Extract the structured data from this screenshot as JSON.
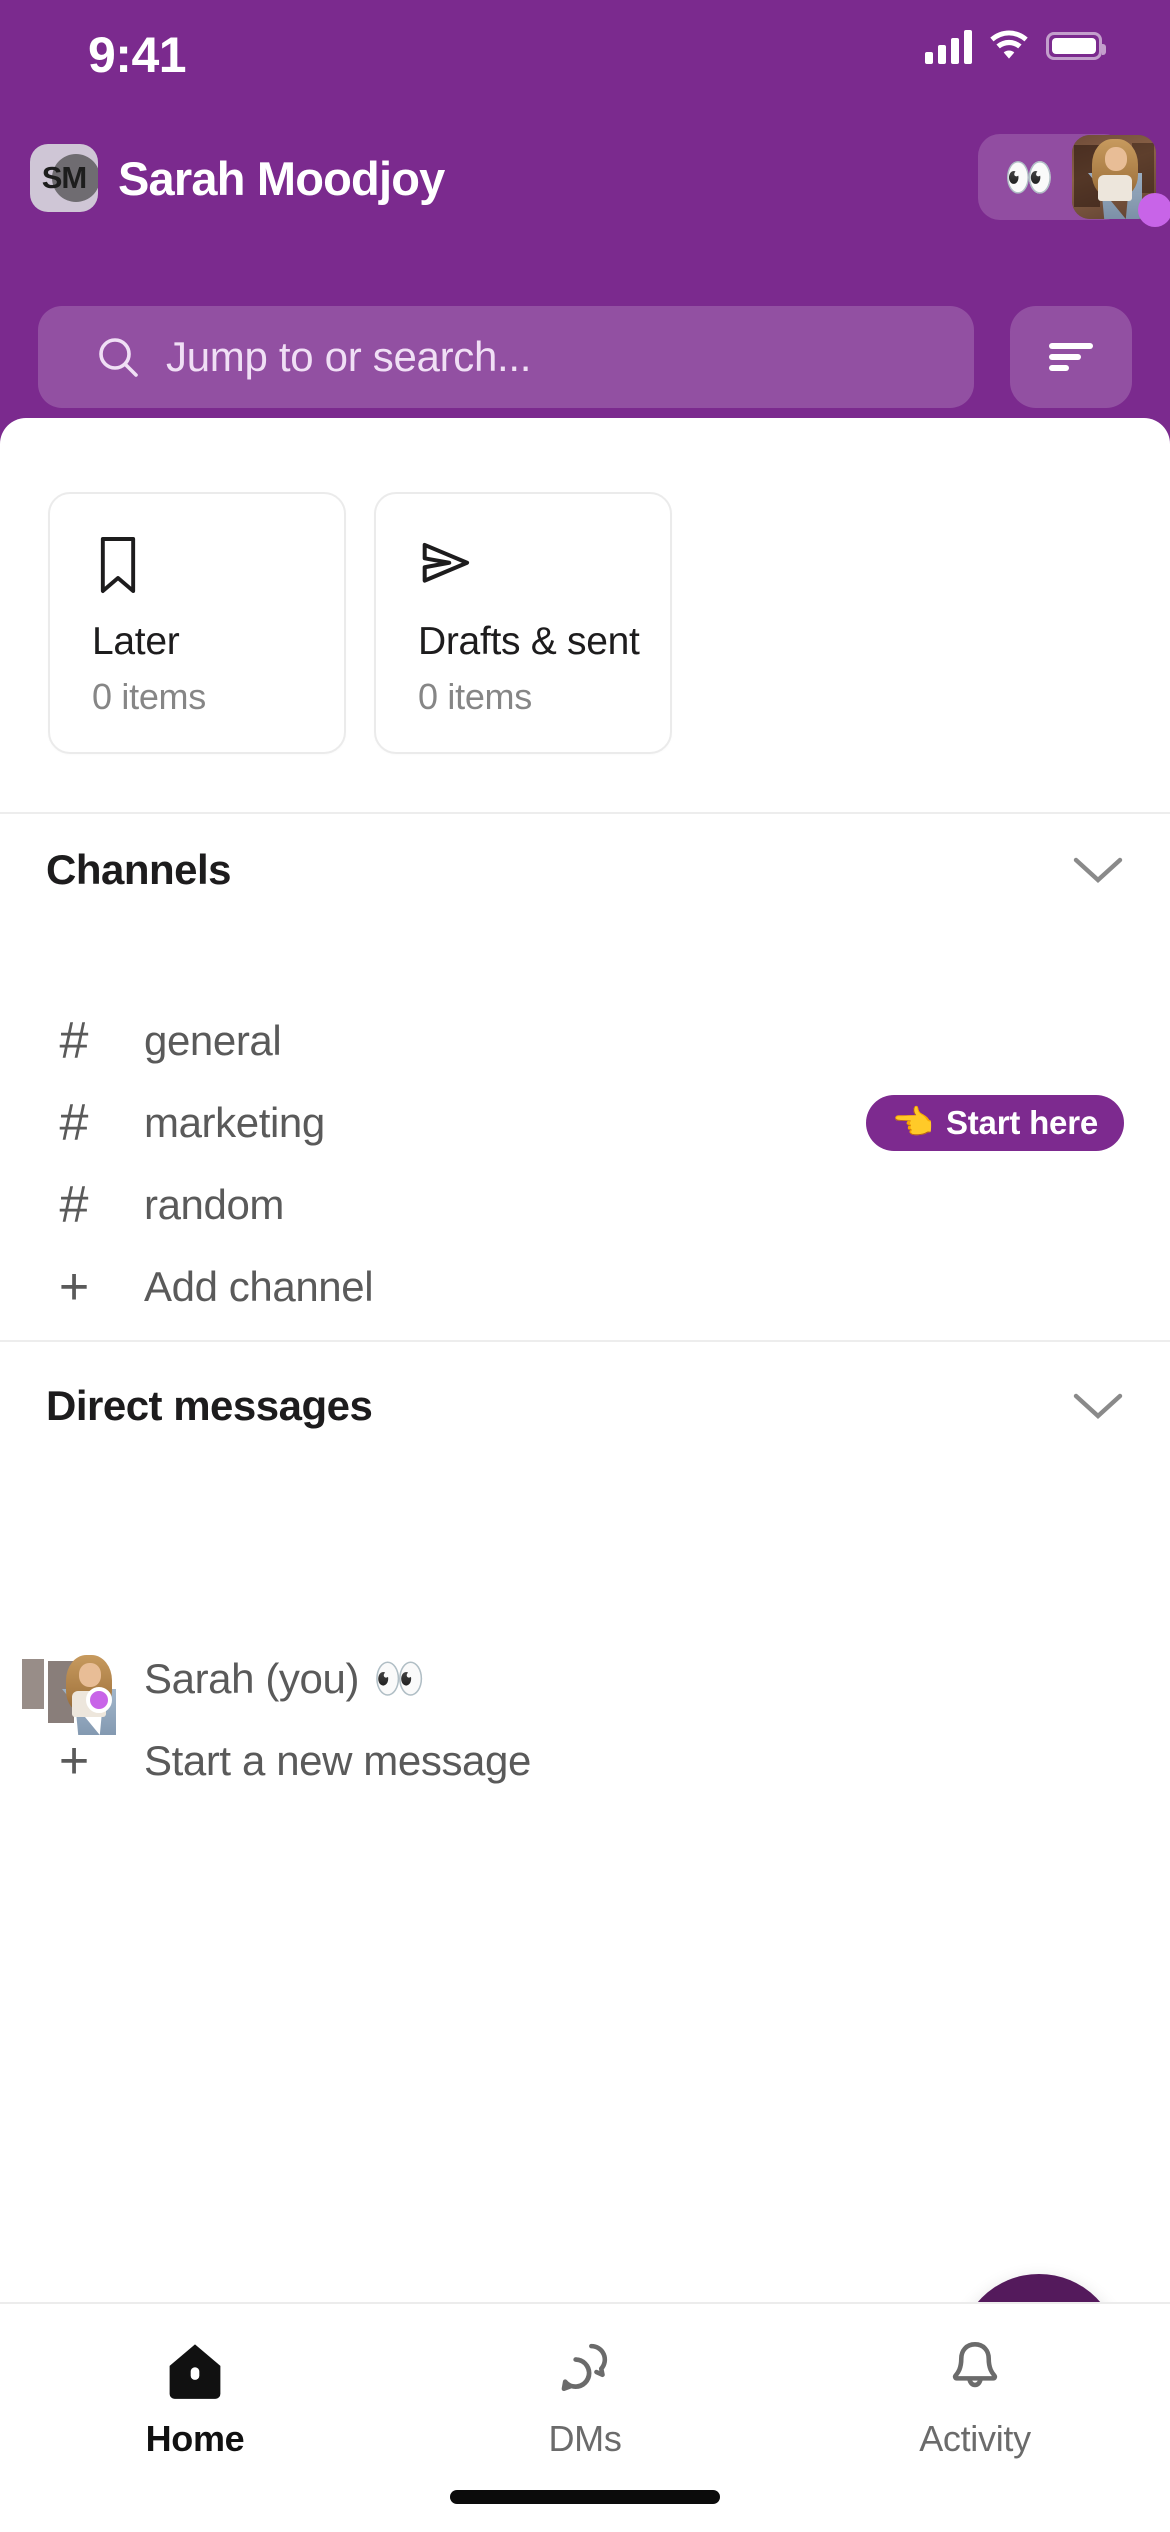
{
  "status_bar": {
    "time": "9:41",
    "icons": [
      "cellular-signal-icon",
      "wifi-icon",
      "battery-icon"
    ]
  },
  "header": {
    "workspace_initials": "SM",
    "workspace_icon_name": "workspace-avatar",
    "title": "Sarah Moodjoy",
    "status_emoji": "👀",
    "presence_color": "#C864E8",
    "avatar_name": "user-avatar",
    "background_color": "#7B2A8E"
  },
  "search": {
    "placeholder": "Jump to or search...",
    "icon": "search-icon",
    "filter_icon": "filter-icon"
  },
  "quick_cards": [
    {
      "icon": "bookmark-icon",
      "label": "Later",
      "count": "0 items"
    },
    {
      "icon": "paper-plane-icon",
      "label": "Drafts & sent",
      "count": "0 items"
    }
  ],
  "channels_section": {
    "title": "Channels",
    "collapse_icon": "chevron-down-icon",
    "items": [
      {
        "glyph": "#",
        "name": "general",
        "badge": null
      },
      {
        "glyph": "#",
        "name": "marketing",
        "badge": {
          "emoji": "👈",
          "label": "Start here",
          "color": "#7D2A8F"
        }
      },
      {
        "glyph": "#",
        "name": "random",
        "badge": null
      },
      {
        "glyph": "+",
        "name": "Add channel",
        "badge": null
      }
    ]
  },
  "dm_section": {
    "title": "Direct messages",
    "collapse_icon": "chevron-down-icon",
    "items": [
      {
        "type": "avatar",
        "name": "Sarah (you)",
        "emoji": "👀",
        "presence_color": "#C864E8"
      },
      {
        "type": "plus",
        "glyph": "+",
        "name": "Start a new message",
        "emoji": ""
      }
    ]
  },
  "compose_fab": {
    "icon": "compose-icon",
    "color": "#541A5C"
  },
  "bottom_nav": [
    {
      "icon": "home-icon",
      "label": "Home",
      "active": true
    },
    {
      "icon": "dms-icon",
      "label": "DMs",
      "active": false
    },
    {
      "icon": "bell-icon",
      "label": "Activity",
      "active": false
    }
  ]
}
